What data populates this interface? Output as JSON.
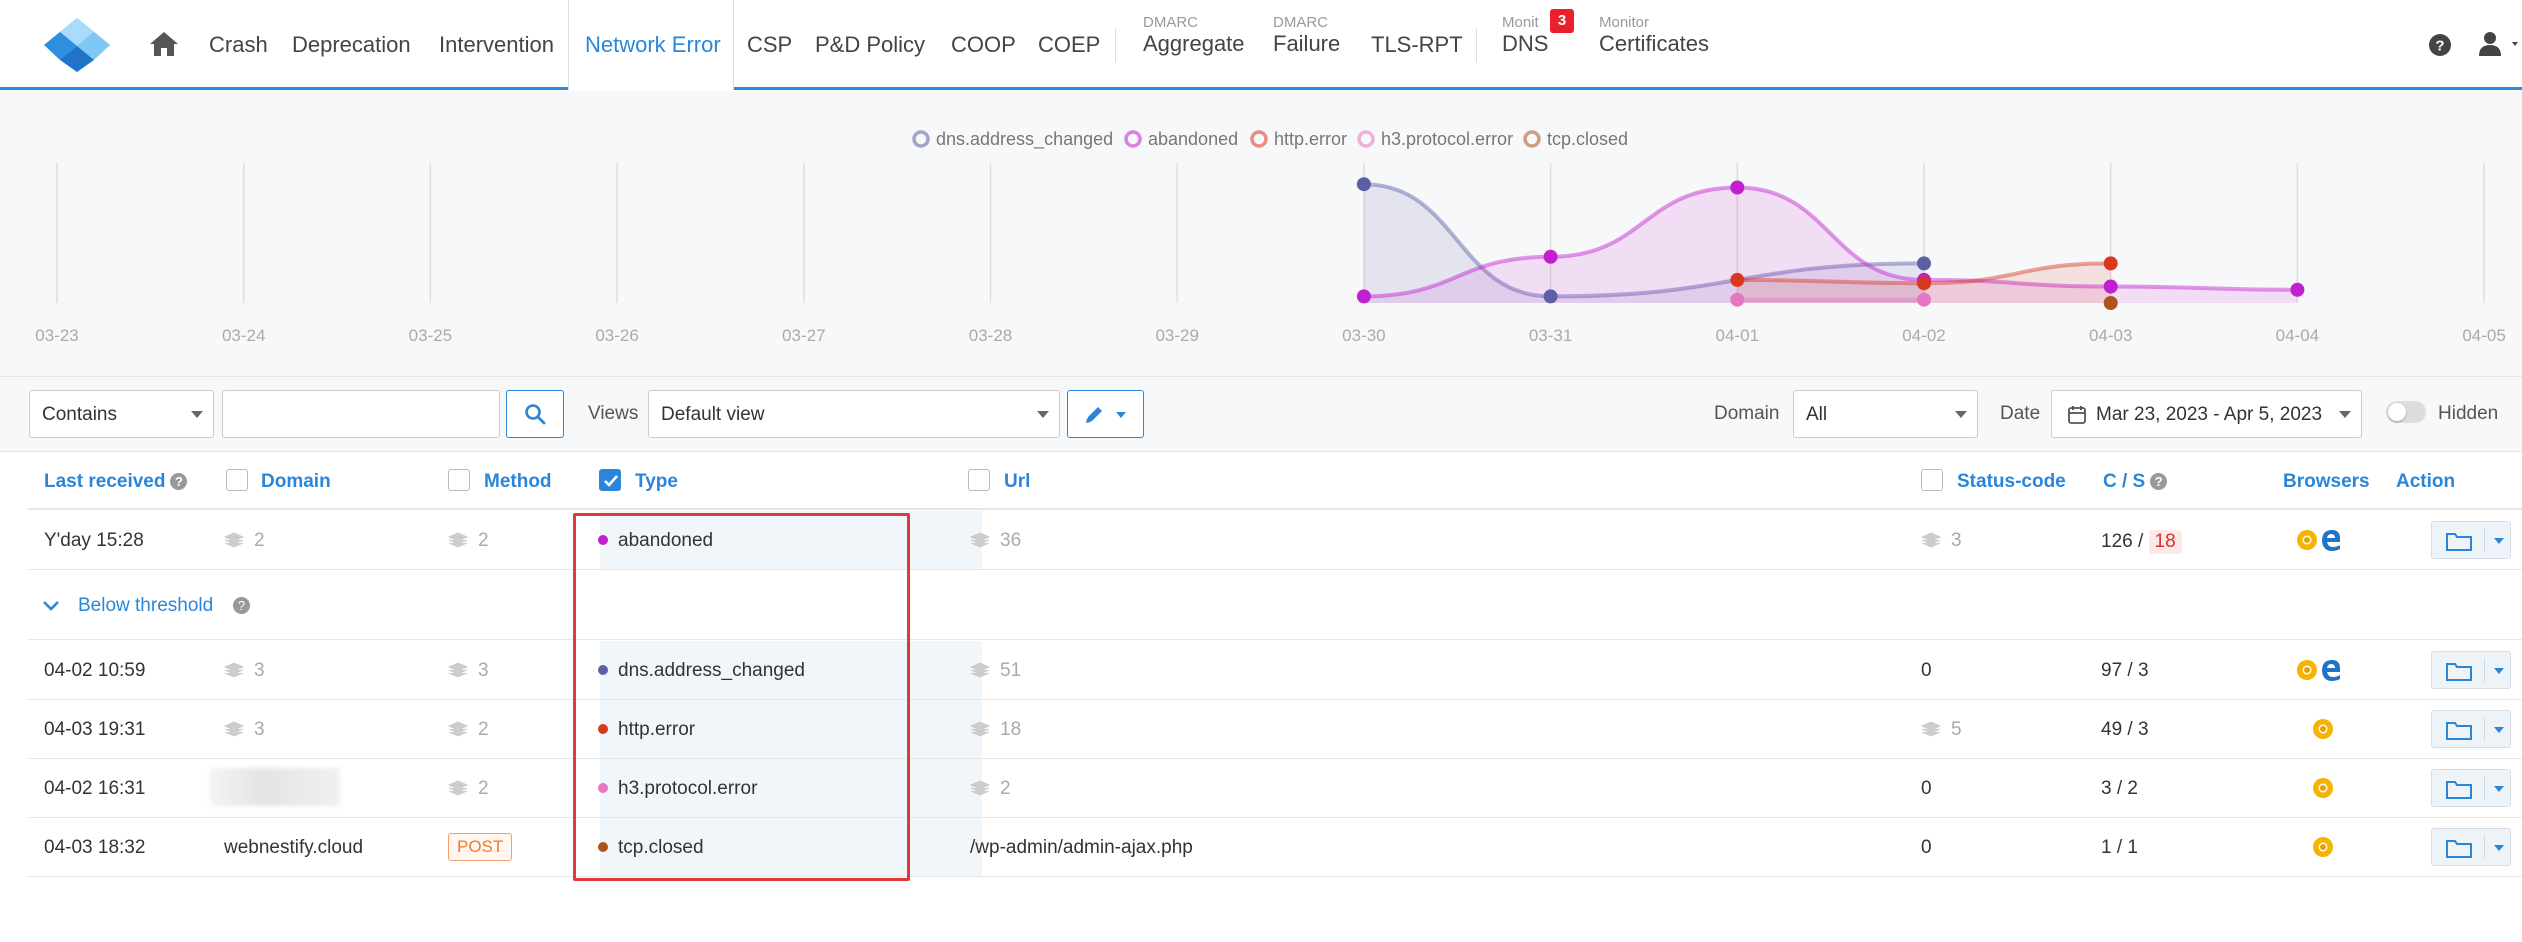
{
  "nav": {
    "items": [
      {
        "label": "Crash"
      },
      {
        "label": "Deprecation"
      },
      {
        "label": "Intervention"
      },
      {
        "label": "Network Error"
      },
      {
        "label": "CSP"
      },
      {
        "label": "P&D Policy"
      },
      {
        "label": "COOP"
      },
      {
        "label": "COEP"
      }
    ],
    "dmarc_aggregate": {
      "sup": "DMARC",
      "label": "Aggregate"
    },
    "dmarc_failure": {
      "sup": "DMARC",
      "label": "Failure"
    },
    "tlsrpt": {
      "label": "TLS-RPT"
    },
    "dns": {
      "sup": "Monit",
      "label": "DNS",
      "badge": "3"
    },
    "certs": {
      "sup": "Monitor",
      "label": "Certificates"
    }
  },
  "chart_data": {
    "type": "line",
    "categories": [
      "03-23",
      "03-24",
      "03-25",
      "03-26",
      "03-27",
      "03-28",
      "03-29",
      "03-30",
      "03-31",
      "04-01",
      "04-02",
      "04-03",
      "04-04",
      "04-05"
    ],
    "ylim": [
      0,
      40
    ],
    "grid": true,
    "legend_position": "top-center",
    "series": [
      {
        "name": "dns.address_changed",
        "color": "#5e5ea6",
        "values": [
          null,
          null,
          null,
          null,
          null,
          null,
          null,
          36,
          2,
          null,
          12,
          null,
          null,
          null
        ]
      },
      {
        "name": "abandoned",
        "color": "#c21fd0",
        "values": [
          null,
          null,
          null,
          null,
          null,
          null,
          null,
          2,
          14,
          35,
          7,
          5,
          4,
          null
        ]
      },
      {
        "name": "http.error",
        "color": "#d9371e",
        "values": [
          null,
          null,
          null,
          null,
          null,
          null,
          null,
          null,
          null,
          7,
          6,
          12,
          null,
          null
        ]
      },
      {
        "name": "h3.protocol.error",
        "color": "#e577c0",
        "values": [
          null,
          null,
          null,
          null,
          null,
          null,
          null,
          null,
          null,
          1,
          1,
          null,
          null,
          null
        ]
      },
      {
        "name": "tcp.closed",
        "color": "#b0531b",
        "values": [
          null,
          null,
          null,
          null,
          null,
          null,
          null,
          null,
          null,
          null,
          null,
          0,
          null,
          null
        ]
      }
    ]
  },
  "toolbar": {
    "match_mode": "Contains",
    "search_value": "",
    "views_label": "Views",
    "view": "Default view",
    "domain_label": "Domain",
    "domain": "All",
    "date_label": "Date",
    "date_range": "Mar 23, 2023 - Apr 5, 2023",
    "hidden_label": "Hidden"
  },
  "table": {
    "headers": {
      "last_received": "Last received",
      "domain": "Domain",
      "method": "Method",
      "type": "Type",
      "url": "Url",
      "status_code": "Status-code",
      "cs": "C / S",
      "browsers": "Browsers",
      "action": "Action"
    },
    "top_row": {
      "last": "Y'day 15:28",
      "domain": "2",
      "method": "2",
      "type": "abandoned",
      "type_color": "#c21fd0",
      "url": "36",
      "status": "3",
      "c": "126 /",
      "s": "18"
    },
    "threshold_label": "Below threshold",
    "rows": [
      {
        "last": "04-02 10:59",
        "domain": "3",
        "method": "3",
        "type": "dns.address_changed",
        "type_color": "#5e5ea6",
        "url": "51",
        "status": "0",
        "cs": "97 / 3"
      },
      {
        "last": "04-03 19:31",
        "domain": "3",
        "method": "2",
        "type": "http.error",
        "type_color": "#d9371e",
        "url": "18",
        "status": "5",
        "cs": "49 / 3"
      },
      {
        "last": "04-02 16:31",
        "method": "2",
        "type": "h3.protocol.error",
        "type_color": "#e577c0",
        "url": "2",
        "status": "0",
        "cs": "3 / 2"
      },
      {
        "last": "04-03 18:32",
        "domain": "webnestify.cloud",
        "method": "POST",
        "type": "tcp.closed",
        "type_color": "#b0531b",
        "url": "/wp-admin/admin-ajax.php",
        "status": "0",
        "cs": "1 / 1"
      }
    ]
  }
}
